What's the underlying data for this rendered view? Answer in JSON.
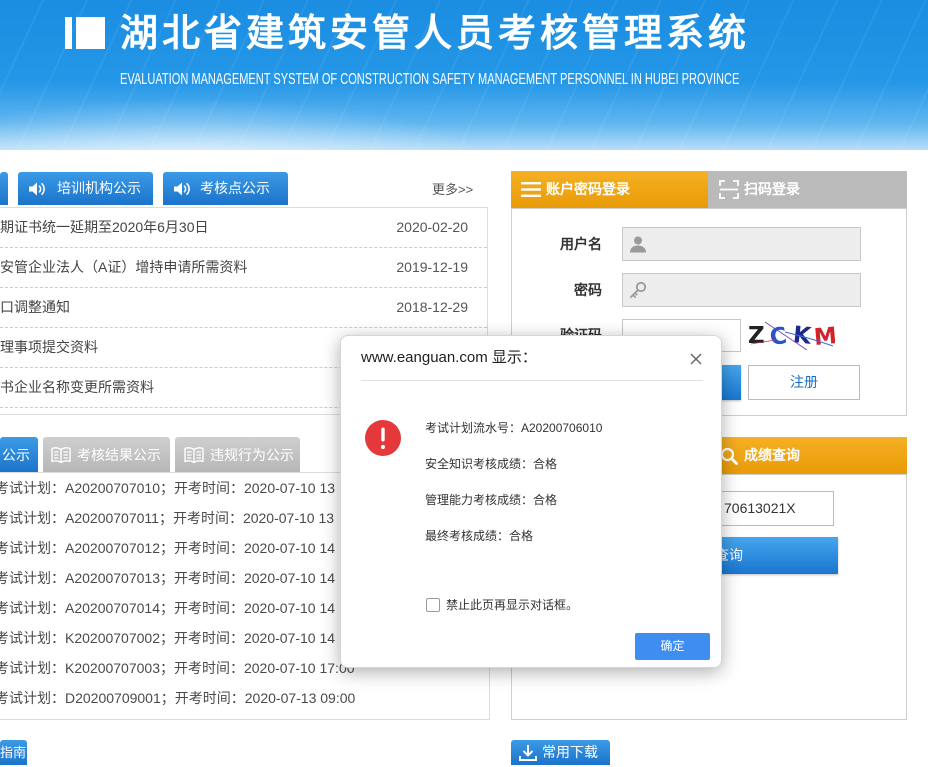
{
  "header": {
    "title": "湖北省建筑安管人员考核管理系统",
    "subtitle": "EVALUATION MANAGEMENT SYSTEM OF CONSTRUCTION SAFETY MANAGEMENT PERSONNEL IN HUBEI PROVINCE"
  },
  "notice_panel": {
    "tabs": [
      {
        "label": "培训机构公示",
        "icon": "speaker-icon"
      },
      {
        "label": "考核点公示",
        "icon": "speaker-icon"
      }
    ],
    "more_label": "更多>>",
    "items": [
      {
        "title": "期证书统一延期至2020年6月30日",
        "date": "2020-02-20"
      },
      {
        "title": "安管企业法人（A证）增持申请所需资料",
        "date": "2019-12-19"
      },
      {
        "title": "口调整通知",
        "date": "2018-12-29"
      },
      {
        "title": "理事项提交资料"
      },
      {
        "title": "书企业名称变更所需资料"
      }
    ]
  },
  "publicity_panel": {
    "tabs": [
      {
        "label": "公示"
      },
      {
        "label": "考核结果公示",
        "icon": "book-icon"
      },
      {
        "label": "违规行为公示",
        "icon": "book-icon"
      }
    ],
    "items": [
      "考试计划：A20200707010；开考时间：2020-07-10 13",
      "考试计划：A20200707011；开考时间：2020-07-10 13",
      "考试计划：A20200707012；开考时间：2020-07-10 14",
      "考试计划：A20200707013；开考时间：2020-07-10 14",
      "考试计划：A20200707014；开考时间：2020-07-10 14",
      "考试计划：K20200707002；开考时间：2020-07-10 14",
      "考试计划：K20200707003；开考时间：2020-07-10 17:00",
      "考试计划：D20200709001；开考时间：2020-07-13 09:00"
    ]
  },
  "login_panel": {
    "tabs": [
      {
        "label": "账户密码登录",
        "icon": "menu-icon"
      },
      {
        "label": "扫码登录",
        "icon": "scan-icon"
      }
    ],
    "username_label": "用户名",
    "username_icon": "user-icon",
    "password_label": "密码",
    "password_icon": "key-icon",
    "captcha_label": "验证码",
    "captcha_image": {
      "chars": [
        "Z",
        "C",
        "K",
        "M"
      ]
    },
    "register_label": "注册"
  },
  "score_panel": {
    "title": "成绩查询",
    "icon": "search-icon",
    "id_value": "70613021X",
    "query_label": "查询"
  },
  "bottom_tabs": {
    "guide_label": "指南",
    "downloads_label": "常用下载",
    "downloads_icon": "download-icon"
  },
  "dialog": {
    "title": "www.eanguan.com 显示：",
    "icon": "alert-icon",
    "lines": [
      "考试计划流水号：A20200706010",
      "安全知识考核成绩：合格",
      "管理能力考核成绩：合格",
      "最终考核成绩：合格"
    ],
    "checkbox_label": "禁止此页再显示对话框。",
    "ok_label": "确定"
  },
  "theme_colors": {
    "header_blue": "#1b8de2",
    "tab_blue": "#1b73ca",
    "tab_orange": "#efa30e",
    "tab_gray": "#c2c2c2",
    "alert_red": "#e5383b",
    "dialog_button": "#3d8ef0"
  }
}
